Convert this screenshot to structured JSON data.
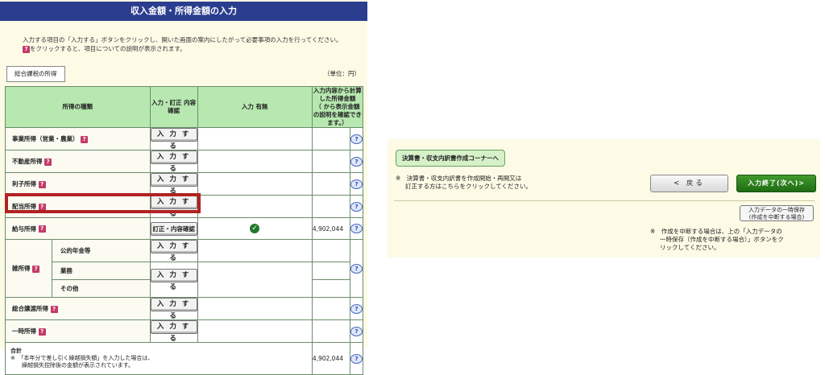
{
  "page_title": "収入金額・所得金額の入力",
  "intro": {
    "line1": "入力する項目の「入力する」ボタンをクリックし、開いた画面の案内にしたがって必要事項の入力を行ってください。",
    "line2": "をクリックすると、項目についての説明が表示されます。"
  },
  "tab_label": "総合課税の所得",
  "unit_label": "（単位：円）",
  "table": {
    "headers": {
      "type": "所得の種類",
      "input": "入力・訂正 内容確認",
      "status": "入力 有無",
      "amount_l1": "入力内容から計算した所得金額",
      "amount_l2": "（ から表示金額の説明を確認できます。）"
    },
    "rows": [
      {
        "label": "事業所得（営業・農業）",
        "button": "入 力 す る",
        "checked": false,
        "amount": ""
      },
      {
        "label": "不動産所得",
        "button": "入 力 す る",
        "checked": false,
        "amount": ""
      },
      {
        "label": "利子所得",
        "button": "入 力 す る",
        "checked": false,
        "amount": ""
      },
      {
        "label": "配当所得",
        "button": "入 力 す る",
        "checked": false,
        "amount": ""
      },
      {
        "label": "給与所得",
        "button": "訂正・内容確認",
        "checked": true,
        "amount": "4,902,044"
      }
    ],
    "misc": {
      "label": "雑所得",
      "sub1": "公的年金等",
      "sub2": "業務",
      "sub3": "その他",
      "button1": "入 力 す る",
      "button2": "入 力 す る"
    },
    "rows2": [
      {
        "label": "総合譲渡所得",
        "button": "入 力 す る"
      },
      {
        "label": "一時所得",
        "button": "入 力 す る"
      }
    ],
    "total": {
      "label": "合計",
      "note1": "※　「本年分で差し引く繰越損失額」を入力した場合は、",
      "note2": "繰越損失控除後の金額が表示されています。",
      "amount": "4,902,044"
    },
    "q_icon": "?",
    "help_icon": "?"
  },
  "right": {
    "kessan_button": "決算書・収支内訳書作成コーナーへ",
    "note1_l1": "※　決算書・収支内訳書を作成開始・再開又は",
    "note1_l2": "訂正する方はこちらをクリックしてください。",
    "back_button": "< 戻る",
    "next_button": "入力終了(次へ)>",
    "save_l1": "入力データの一時保存",
    "save_l2": "(作成を中断する場合)",
    "note2_l1": "※　作成を中断する場合は、上の「入力データの",
    "note2_l2": "一時保存（作成を中断する場合）」ボタンをク",
    "note2_l3": "リックしてください。"
  },
  "colors": {
    "title_bg": "#2b3d8f",
    "header_green": "#b7e8b0",
    "highlight": "#b22222",
    "next_green": "#1f6b14"
  }
}
